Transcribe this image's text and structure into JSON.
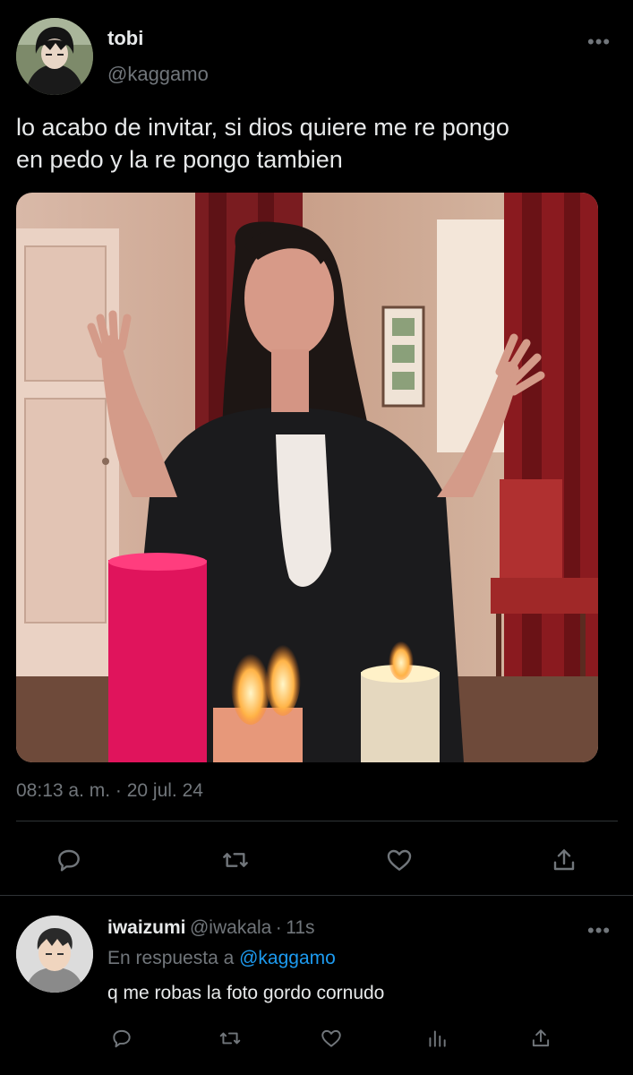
{
  "tweet": {
    "display_name": "tobi",
    "handle": "@kaggamo",
    "text_line1": "lo acabo de invitar, si dios quiere me re pongo",
    "text_line2": "en pedo y la re pongo tambien",
    "timestamp": "08:13 a. m. · 20 jul. 24",
    "more_label": "•••"
  },
  "reply": {
    "display_name": "iwaizumi",
    "handle": "@iwakala",
    "separator": "·",
    "time": "11s",
    "context_prefix": "En respuesta a",
    "context_mention": "@kaggamo",
    "text": "q me robas la foto gordo cornudo",
    "more_label": "•••"
  },
  "icons": {
    "actions": [
      "reply-icon",
      "retweet-icon",
      "like-icon",
      "share-icon"
    ],
    "reply_actions": [
      "reply-icon",
      "retweet-icon",
      "like-icon",
      "analytics-icon",
      "share-icon"
    ]
  },
  "colors": {
    "background": "#000000",
    "text": "#e7e9ea",
    "secondary": "#71767b",
    "accent": "#1d9bf0",
    "divider": "#2f3336"
  }
}
